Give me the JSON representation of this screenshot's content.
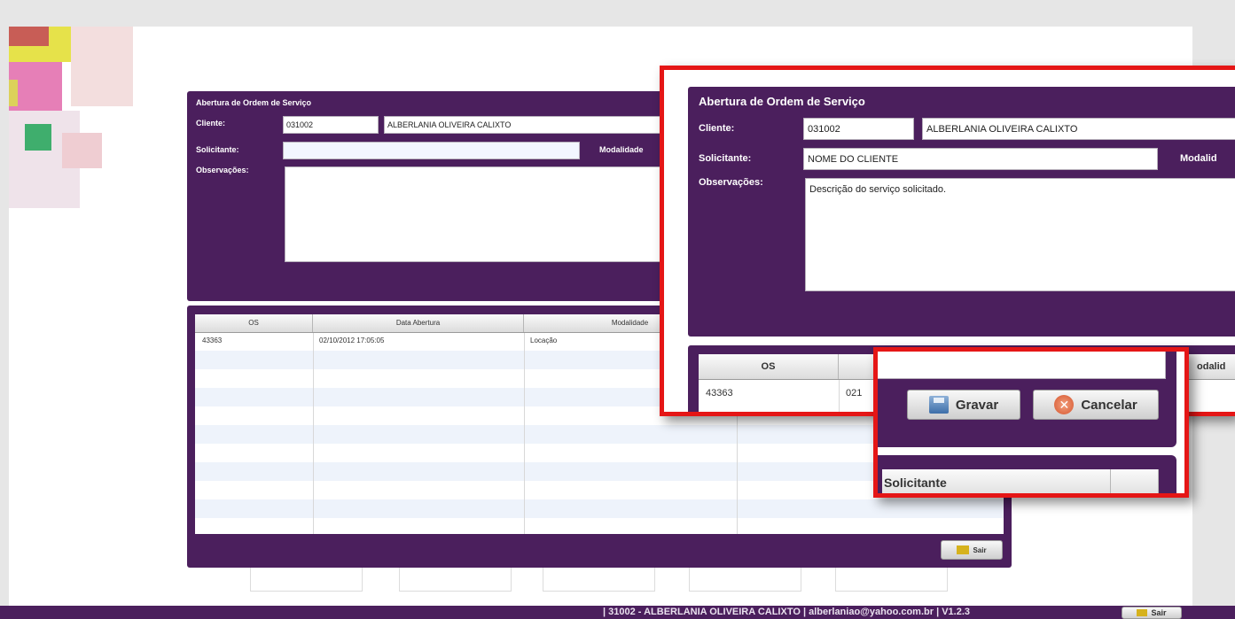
{
  "form": {
    "title": "Abertura de Ordem de Serviço",
    "client_label": "Cliente:",
    "client_code": "031002",
    "client_name": "ALBERLANIA OLIVEIRA CALIXTO",
    "requester_label": "Solicitante:",
    "requester_value_zoom": "NOME DO CLIENTE",
    "modality_label": "Modalidade",
    "modality_label_zoom": "Modalid",
    "notes_label": "Observações:",
    "notes_value_zoom": "Descrição do serviço solicitado."
  },
  "table": {
    "headers": [
      "OS",
      "Data Abertura",
      "Modalidade"
    ],
    "rows": [
      {
        "os": "43363",
        "date": "02/10/2012 17:05:05",
        "modality": "Locação"
      }
    ],
    "zoom_headers": [
      "OS",
      "odalid"
    ],
    "zoom_row": {
      "os": "43363",
      "date": "021"
    }
  },
  "buttons": {
    "save": "Gravar",
    "cancel": "Cancelar",
    "exit": "Sair"
  },
  "zoom2": {
    "requester_header": "Solicitante"
  },
  "footer": {
    "status": "| 31002 - ALBERLANIA OLIVEIRA CALIXTO | alberlaniao@yahoo.com.br | V1.2.3",
    "exit": "Sair"
  },
  "colors": {
    "panel": "#4b1f5d",
    "highlight": "#e51616"
  }
}
